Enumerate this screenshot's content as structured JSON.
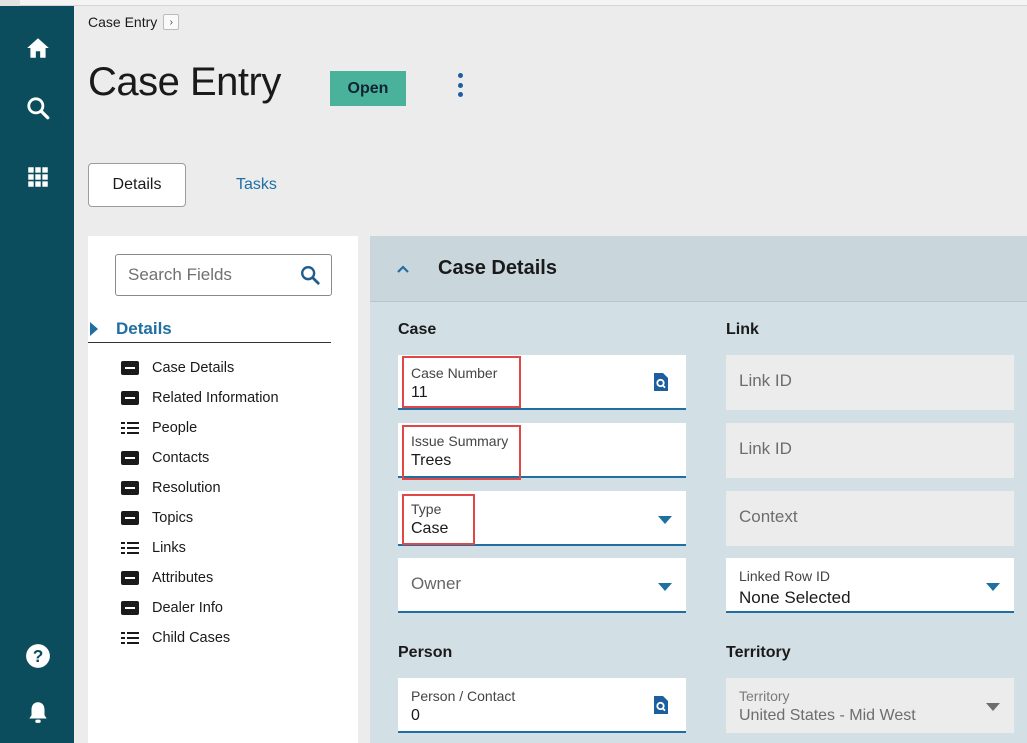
{
  "breadcrumb": {
    "label": "Case Entry",
    "chevron": "›"
  },
  "header": {
    "title": "Case Entry",
    "status": "Open"
  },
  "tabs": {
    "details": "Details",
    "tasks": "Tasks"
  },
  "sidenav": {
    "icons": [
      "home-icon",
      "search-icon",
      "apps-grid-icon",
      "help-icon",
      "bell-icon"
    ]
  },
  "field_nav": {
    "search_placeholder": "Search Fields",
    "section": "Details",
    "items": [
      {
        "label": "Case Details",
        "icon": "card"
      },
      {
        "label": "Related Information",
        "icon": "card"
      },
      {
        "label": "People",
        "icon": "list"
      },
      {
        "label": "Contacts",
        "icon": "card"
      },
      {
        "label": "Resolution",
        "icon": "card"
      },
      {
        "label": "Topics",
        "icon": "card"
      },
      {
        "label": "Links",
        "icon": "list"
      },
      {
        "label": "Attributes",
        "icon": "card"
      },
      {
        "label": "Dealer Info",
        "icon": "card"
      },
      {
        "label": "Child Cases",
        "icon": "list"
      }
    ]
  },
  "form": {
    "section_title": "Case Details",
    "case_group": "Case",
    "link_group": "Link",
    "person_group": "Person",
    "territory_group": "Territory",
    "case_number": {
      "label": "Case Number",
      "value": "11"
    },
    "issue_summary": {
      "label": "Issue Summary",
      "value": "Trees"
    },
    "type": {
      "label": "Type",
      "value": "Case"
    },
    "owner": {
      "placeholder": "Owner"
    },
    "link_id_1": {
      "placeholder": "Link ID"
    },
    "link_id_2": {
      "placeholder": "Link ID"
    },
    "context": {
      "placeholder": "Context"
    },
    "linked_row": {
      "label": "Linked Row ID",
      "value": "None Selected"
    },
    "person_contact": {
      "label": "Person / Contact",
      "value": "0"
    },
    "territory": {
      "label": "Territory",
      "value": "United States - Mid West"
    }
  },
  "colors": {
    "sidenav": "#0b4d5c",
    "status_badge": "#4ab29b",
    "accent": "#1f6fa3",
    "form_bg": "#d2e0e6",
    "highlight": "#e04848"
  }
}
